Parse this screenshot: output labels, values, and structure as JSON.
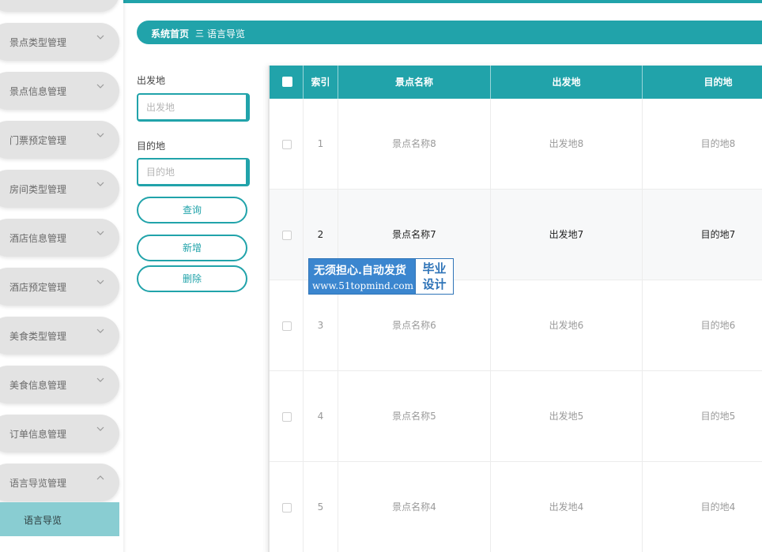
{
  "sidebar": {
    "items": [
      {
        "label": ""
      },
      {
        "label": "景点类型管理"
      },
      {
        "label": "景点信息管理"
      },
      {
        "label": "门票预定管理"
      },
      {
        "label": "房间类型管理"
      },
      {
        "label": "酒店信息管理"
      },
      {
        "label": "酒店预定管理"
      },
      {
        "label": "美食类型管理"
      },
      {
        "label": "美食信息管理"
      },
      {
        "label": "订单信息管理"
      },
      {
        "label": "语言导览管理"
      }
    ],
    "active_sub_item": {
      "label": "语言导览"
    }
  },
  "breadcrumb": {
    "home": "系统首页",
    "separator": "三",
    "current": "语言导览"
  },
  "search": {
    "departure_label": "出发地",
    "departure_placeholder": "出发地",
    "destination_label": "目的地",
    "destination_placeholder": "目的地",
    "query_button": "查询",
    "add_button": "新增",
    "delete_button": "删除"
  },
  "table": {
    "columns": [
      "索引",
      "景点名称",
      "出发地",
      "目的地"
    ],
    "rows": [
      {
        "index": "1",
        "name": "景点名称8",
        "from": "出发地8",
        "to": "目的地8"
      },
      {
        "index": "2",
        "name": "景点名称7",
        "from": "出发地7",
        "to": "目的地7"
      },
      {
        "index": "3",
        "name": "景点名称6",
        "from": "出发地6",
        "to": "目的地6"
      },
      {
        "index": "4",
        "name": "景点名称5",
        "from": "出发地5",
        "to": "目的地5"
      },
      {
        "index": "5",
        "name": "景点名称4",
        "from": "出发地4",
        "to": "目的地4"
      }
    ]
  },
  "watermark": {
    "line1": "无须担心.自动发货",
    "line2": "www.51topmind.com",
    "badge_line1": "毕业",
    "badge_line2": "设计"
  },
  "colors": {
    "accent": "#21a3aa",
    "sub_item_bg": "#89cdd2",
    "menu_bg": "#e3e3e3"
  }
}
